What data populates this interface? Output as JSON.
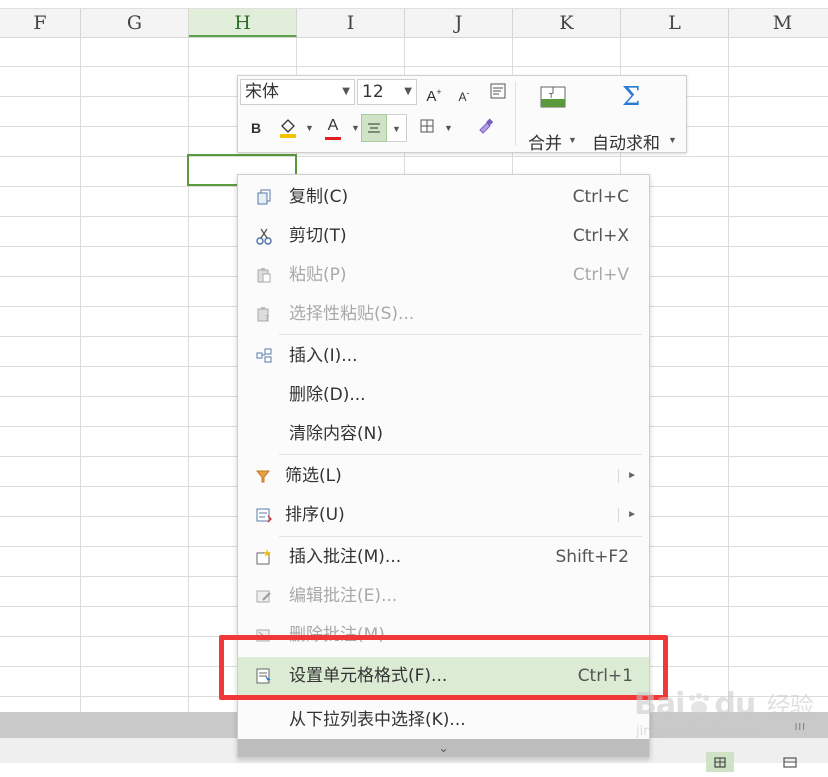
{
  "columns": [
    "F",
    "G",
    "H",
    "I",
    "J",
    "K",
    "L",
    "M"
  ],
  "selected_column": "H",
  "mini_toolbar": {
    "font_name": "宋体",
    "font_size": "12",
    "grow_font_icon": "A",
    "shrink_font_icon": "A",
    "bold_label": "B",
    "font_color_label": "A",
    "merge_label": "合并",
    "autosum_label": "自动求和",
    "autosum_symbol": "Σ",
    "accent_color": "#5a9a3c",
    "font_color": "#e02020",
    "fill_color": "#f5c400"
  },
  "context_menu": {
    "items": [
      {
        "label": "复制(C)",
        "shortcut": "Ctrl+C",
        "icon": "copy-icon"
      },
      {
        "label": "剪切(T)",
        "shortcut": "Ctrl+X",
        "icon": "scissors-icon"
      },
      {
        "label": "粘贴(P)",
        "shortcut": "Ctrl+V",
        "icon": "paste-icon"
      },
      {
        "label": "选择性粘贴(S)...",
        "icon": "paste-special-icon"
      },
      {
        "label": "插入(I)...",
        "icon": "insert-icon"
      },
      {
        "label": "删除(D)..."
      },
      {
        "label": "清除内容(N)"
      },
      {
        "label": "筛选(L)",
        "icon": "filter-icon"
      },
      {
        "label": "排序(U)",
        "icon": "sort-icon"
      },
      {
        "label": "插入批注(M)...",
        "shortcut": "Shift+F2",
        "icon": "insert-comment-icon"
      },
      {
        "label": "编辑批注(E)...",
        "icon": "edit-comment-icon"
      },
      {
        "label": "删除批注(M)",
        "icon": "delete-comment-icon"
      },
      {
        "label": "设置单元格格式(F)...",
        "shortcut": "Ctrl+1",
        "icon": "format-cells-icon"
      },
      {
        "label": "从下拉列表中选择(K)..."
      }
    ],
    "highlight_color": "#dcebd3"
  },
  "annotation_color": "#f03838",
  "watermark": {
    "brand": "Bai",
    "brand_suffix": "du",
    "cn_text": "经验",
    "url": "jingyan.baidu.com"
  },
  "scroll_grip": "III"
}
